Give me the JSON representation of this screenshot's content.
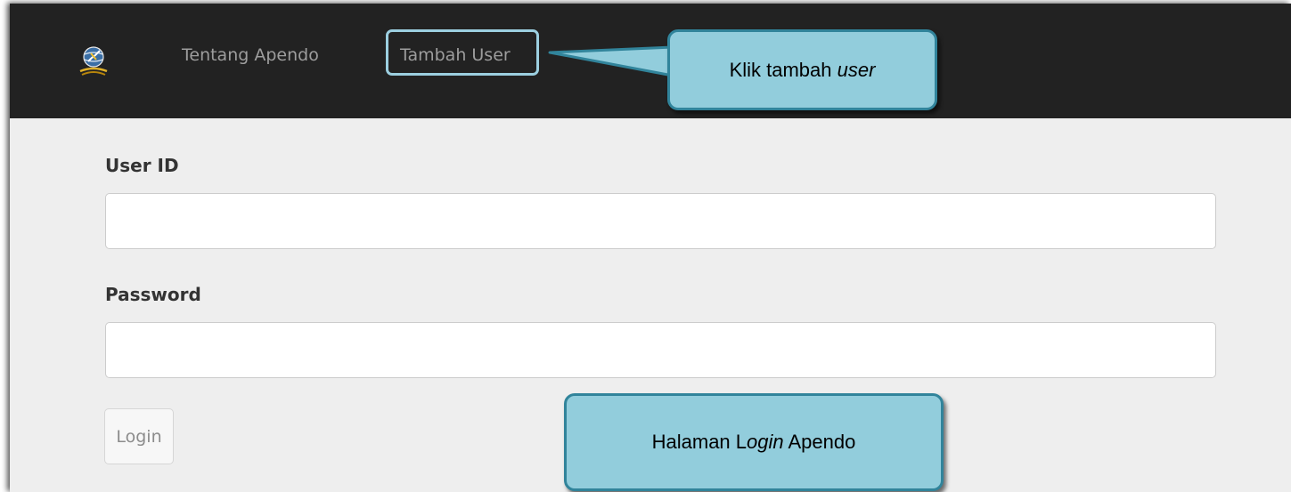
{
  "navbar": {
    "logo_icon": "apendo-globe-logo-icon",
    "links": [
      {
        "label": "Tentang Apendo"
      },
      {
        "label": "Tambah User"
      }
    ]
  },
  "form": {
    "user_id": {
      "label": "User ID",
      "value": ""
    },
    "password": {
      "label": "Password",
      "value": ""
    },
    "login_button": "Login"
  },
  "annotations": {
    "tambah_user": {
      "prefix": "Klik tambah ",
      "emphasis": "user",
      "suffix": ""
    },
    "login_page": {
      "prefix": "Halaman L",
      "emphasis": "ogin",
      "suffix": " Apendo"
    }
  },
  "colors": {
    "navbar_bg": "#222222",
    "page_bg": "#eeeeee",
    "callout_fill": "#92cddc",
    "callout_border": "#31849b",
    "highlight_border": "#9ccfe0"
  }
}
